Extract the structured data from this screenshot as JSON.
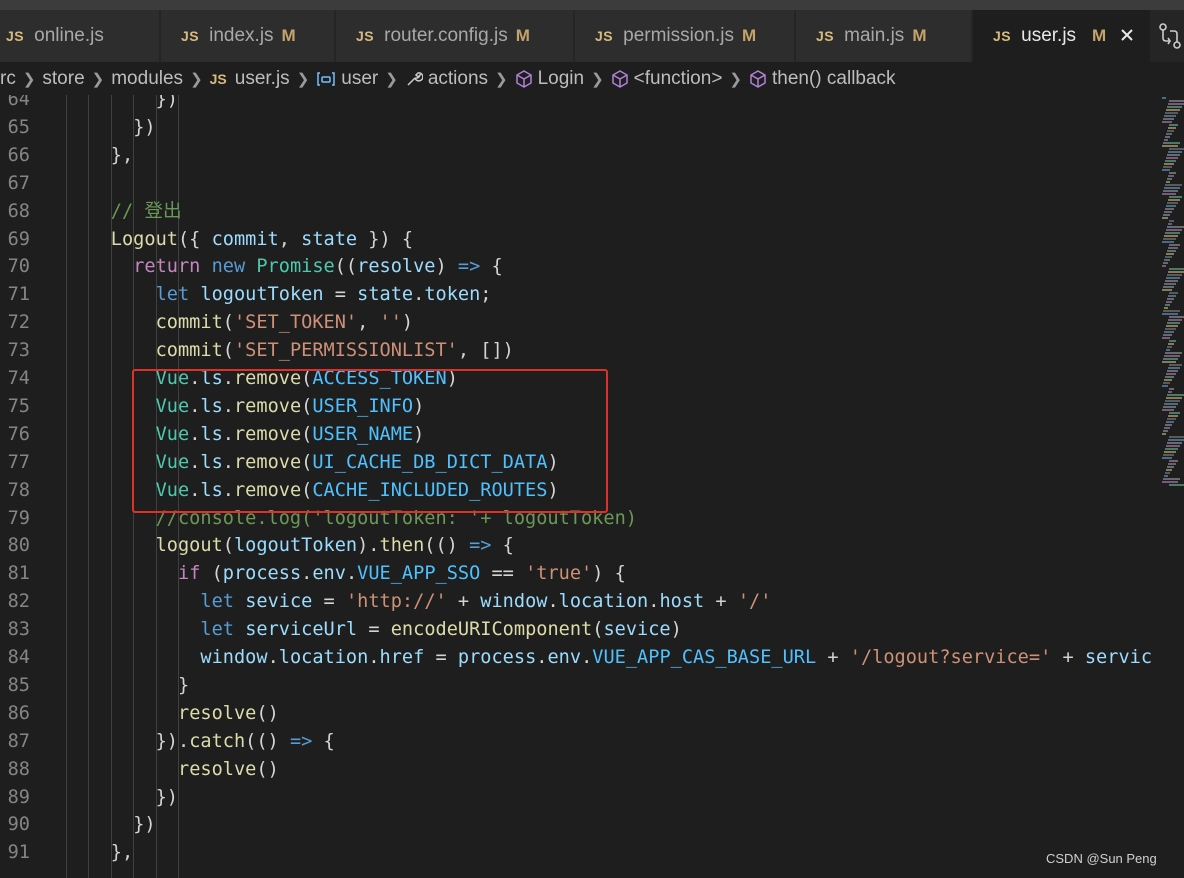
{
  "tabs": [
    {
      "name": "online.js",
      "modified": ""
    },
    {
      "name": "index.js",
      "modified": "M"
    },
    {
      "name": "router.config.js",
      "modified": "M"
    },
    {
      "name": "permission.js",
      "modified": "M"
    },
    {
      "name": "main.js",
      "modified": "M"
    },
    {
      "name": "user.js",
      "modified": "M",
      "active": true
    }
  ],
  "file_badge": "JS",
  "breadcrumb": {
    "items": [
      "rc",
      "store",
      "modules",
      "user.js",
      "user",
      "actions",
      "Login",
      "<function>",
      "then() callback"
    ]
  },
  "code_lines": [
    {
      "num": "64"
    },
    {
      "num": "65"
    },
    {
      "num": "66"
    },
    {
      "num": "67"
    },
    {
      "num": "68"
    },
    {
      "num": "69"
    },
    {
      "num": "70"
    },
    {
      "num": "71"
    },
    {
      "num": "72"
    },
    {
      "num": "73"
    },
    {
      "num": "74"
    },
    {
      "num": "75"
    },
    {
      "num": "76"
    },
    {
      "num": "77"
    },
    {
      "num": "78"
    },
    {
      "num": "79"
    },
    {
      "num": "80"
    },
    {
      "num": "81"
    },
    {
      "num": "82"
    },
    {
      "num": "83"
    },
    {
      "num": "84"
    },
    {
      "num": "85"
    },
    {
      "num": "86"
    },
    {
      "num": "87"
    },
    {
      "num": "88"
    },
    {
      "num": "89"
    },
    {
      "num": "90"
    },
    {
      "num": "91"
    }
  ],
  "code": {
    "l64": [
      [
        "t-def",
        "})"
      ]
    ],
    "l65": [
      [
        "t-def",
        "})"
      ]
    ],
    "l66": [
      [
        "t-def",
        "},"
      ]
    ],
    "l67": [],
    "l68": [
      [
        "t-cmt",
        "// 登出"
      ]
    ],
    "l69": [
      [
        "t-fn",
        "Logout"
      ],
      [
        "t-def",
        "({ "
      ],
      [
        "t-var",
        "commit"
      ],
      [
        "t-def",
        ", "
      ],
      [
        "t-var",
        "state"
      ],
      [
        "t-def",
        " }) {"
      ]
    ],
    "l70": [
      [
        "t-ctl",
        "return"
      ],
      [
        "t-def",
        " "
      ],
      [
        "t-kw",
        "new"
      ],
      [
        "t-def",
        " "
      ],
      [
        "t-cls",
        "Promise"
      ],
      [
        "t-def",
        "(("
      ],
      [
        "t-var",
        "resolve"
      ],
      [
        "t-def",
        ") "
      ],
      [
        "t-kw",
        "=>"
      ],
      [
        "t-def",
        " {"
      ]
    ],
    "l71": [
      [
        "t-kw",
        "let"
      ],
      [
        "t-def",
        " "
      ],
      [
        "t-var",
        "logoutToken"
      ],
      [
        "t-def",
        " = "
      ],
      [
        "t-var",
        "state"
      ],
      [
        "t-def",
        "."
      ],
      [
        "t-var",
        "token"
      ],
      [
        "t-def",
        ";"
      ]
    ],
    "l72": [
      [
        "t-fn",
        "commit"
      ],
      [
        "t-def",
        "("
      ],
      [
        "t-str",
        "'SET_TOKEN'"
      ],
      [
        "t-def",
        ", "
      ],
      [
        "t-str",
        "''"
      ],
      [
        "t-def",
        ")"
      ]
    ],
    "l73": [
      [
        "t-fn",
        "commit"
      ],
      [
        "t-def",
        "("
      ],
      [
        "t-str",
        "'SET_PERMISSIONLIST'"
      ],
      [
        "t-def",
        ", [])"
      ]
    ],
    "l74": [
      [
        "t-cls",
        "Vue"
      ],
      [
        "t-def",
        "."
      ],
      [
        "t-var",
        "ls"
      ],
      [
        "t-def",
        "."
      ],
      [
        "t-fn",
        "remove"
      ],
      [
        "t-def",
        "("
      ],
      [
        "t-const",
        "ACCESS_TOKEN"
      ],
      [
        "t-def",
        ")"
      ]
    ],
    "l75": [
      [
        "t-cls",
        "Vue"
      ],
      [
        "t-def",
        "."
      ],
      [
        "t-var",
        "ls"
      ],
      [
        "t-def",
        "."
      ],
      [
        "t-fn",
        "remove"
      ],
      [
        "t-def",
        "("
      ],
      [
        "t-const",
        "USER_INFO"
      ],
      [
        "t-def",
        ")"
      ]
    ],
    "l76": [
      [
        "t-cls",
        "Vue"
      ],
      [
        "t-def",
        "."
      ],
      [
        "t-var",
        "ls"
      ],
      [
        "t-def",
        "."
      ],
      [
        "t-fn",
        "remove"
      ],
      [
        "t-def",
        "("
      ],
      [
        "t-const",
        "USER_NAME"
      ],
      [
        "t-def",
        ")"
      ]
    ],
    "l77": [
      [
        "t-cls",
        "Vue"
      ],
      [
        "t-def",
        "."
      ],
      [
        "t-var",
        "ls"
      ],
      [
        "t-def",
        "."
      ],
      [
        "t-fn",
        "remove"
      ],
      [
        "t-def",
        "("
      ],
      [
        "t-const",
        "UI_CACHE_DB_DICT_DATA"
      ],
      [
        "t-def",
        ")"
      ]
    ],
    "l78": [
      [
        "t-cls",
        "Vue"
      ],
      [
        "t-def",
        "."
      ],
      [
        "t-var",
        "ls"
      ],
      [
        "t-def",
        "."
      ],
      [
        "t-fn",
        "remove"
      ],
      [
        "t-def",
        "("
      ],
      [
        "t-const",
        "CACHE_INCLUDED_ROUTES"
      ],
      [
        "t-def",
        ")"
      ]
    ],
    "l79": [
      [
        "t-cmt",
        "//console.log('logoutToken: '+ logoutToken)"
      ]
    ],
    "l80": [
      [
        "t-fn",
        "logout"
      ],
      [
        "t-def",
        "("
      ],
      [
        "t-var",
        "logoutToken"
      ],
      [
        "t-def",
        ")."
      ],
      [
        "t-fn",
        "then"
      ],
      [
        "t-def",
        "(() "
      ],
      [
        "t-kw",
        "=>"
      ],
      [
        "t-def",
        " {"
      ]
    ],
    "l81": [
      [
        "t-ctl",
        "if"
      ],
      [
        "t-def",
        " ("
      ],
      [
        "t-var",
        "process"
      ],
      [
        "t-def",
        "."
      ],
      [
        "t-var",
        "env"
      ],
      [
        "t-def",
        "."
      ],
      [
        "t-const",
        "VUE_APP_SSO"
      ],
      [
        "t-def",
        " == "
      ],
      [
        "t-str",
        "'true'"
      ],
      [
        "t-def",
        ") {"
      ]
    ],
    "l82": [
      [
        "t-kw",
        "let"
      ],
      [
        "t-def",
        " "
      ],
      [
        "t-var",
        "sevice"
      ],
      [
        "t-def",
        " = "
      ],
      [
        "t-str",
        "'http://'"
      ],
      [
        "t-def",
        " + "
      ],
      [
        "t-var",
        "window"
      ],
      [
        "t-def",
        "."
      ],
      [
        "t-var",
        "location"
      ],
      [
        "t-def",
        "."
      ],
      [
        "t-var",
        "host"
      ],
      [
        "t-def",
        " + "
      ],
      [
        "t-str",
        "'/'"
      ]
    ],
    "l83": [
      [
        "t-kw",
        "let"
      ],
      [
        "t-def",
        " "
      ],
      [
        "t-var",
        "serviceUrl"
      ],
      [
        "t-def",
        " = "
      ],
      [
        "t-fn",
        "encodeURIComponent"
      ],
      [
        "t-def",
        "("
      ],
      [
        "t-var",
        "sevice"
      ],
      [
        "t-def",
        ")"
      ]
    ],
    "l84": [
      [
        "t-var",
        "window"
      ],
      [
        "t-def",
        "."
      ],
      [
        "t-var",
        "location"
      ],
      [
        "t-def",
        "."
      ],
      [
        "t-var",
        "href"
      ],
      [
        "t-def",
        " = "
      ],
      [
        "t-var",
        "process"
      ],
      [
        "t-def",
        "."
      ],
      [
        "t-var",
        "env"
      ],
      [
        "t-def",
        "."
      ],
      [
        "t-const",
        "VUE_APP_CAS_BASE_URL"
      ],
      [
        "t-def",
        " + "
      ],
      [
        "t-str",
        "'/logout?service='"
      ],
      [
        "t-def",
        " + "
      ],
      [
        "t-var",
        "servic"
      ]
    ],
    "l85": [
      [
        "t-def",
        "}"
      ]
    ],
    "l86": [
      [
        "t-fn",
        "resolve"
      ],
      [
        "t-def",
        "()"
      ]
    ],
    "l87": [
      [
        "t-def",
        "})."
      ],
      [
        "t-fn",
        "catch"
      ],
      [
        "t-def",
        "(() "
      ],
      [
        "t-kw",
        "=>"
      ],
      [
        "t-def",
        " {"
      ]
    ],
    "l88": [
      [
        "t-fn",
        "resolve"
      ],
      [
        "t-def",
        "()"
      ]
    ],
    "l89": [
      [
        "t-def",
        "})"
      ]
    ],
    "l90": [
      [
        "t-def",
        "})"
      ]
    ],
    "l91": [
      [
        "t-def",
        "},"
      ]
    ]
  },
  "watermark": "CSDN @Sun  Peng",
  "colors": {
    "highlight_box": "#e0302a",
    "modified_marker": "#c4a46b",
    "js_badge": "#d7ba7d"
  }
}
